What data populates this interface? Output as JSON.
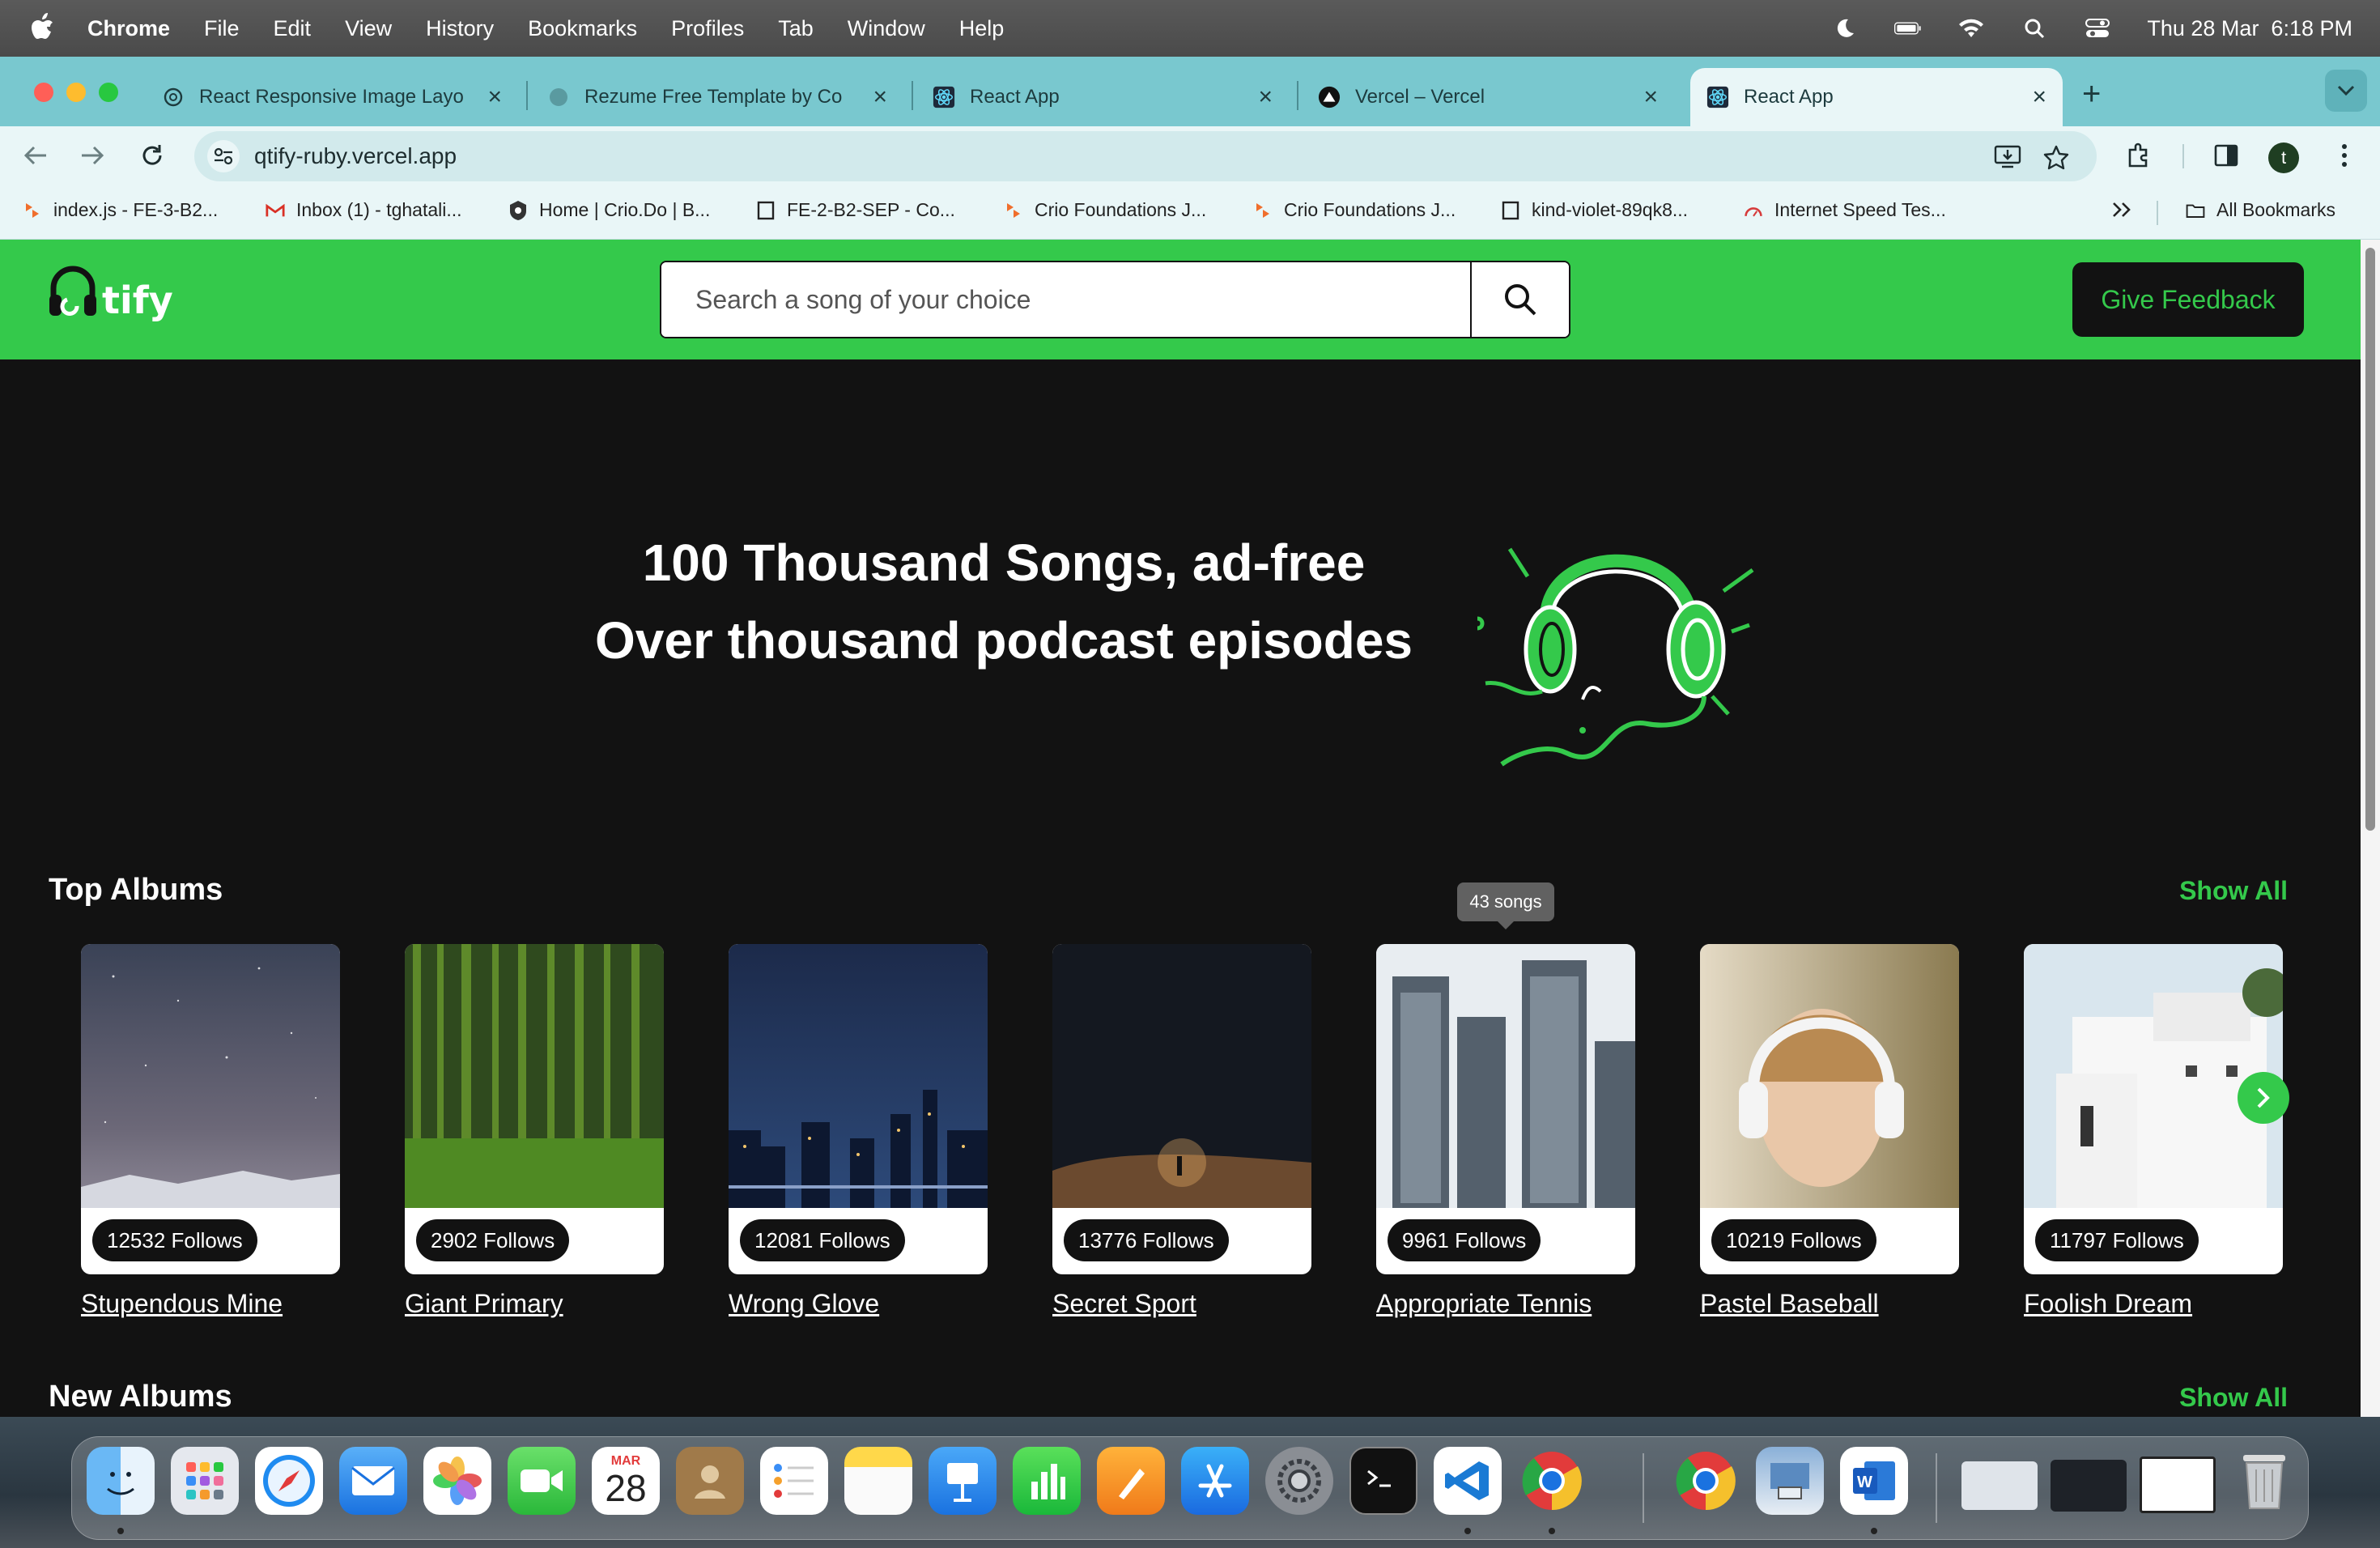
{
  "menubar": {
    "app": "Chrome",
    "items": [
      "File",
      "Edit",
      "View",
      "History",
      "Bookmarks",
      "Profiles",
      "Tab",
      "Window",
      "Help"
    ],
    "datetime": "Thu 28 Mar  6:18 PM"
  },
  "tabs": [
    {
      "title": "React Responsive Image Layo",
      "icon": "openai-icon"
    },
    {
      "title": "Rezume Free Template by Co",
      "icon": "globe-icon"
    },
    {
      "title": "React App",
      "icon": "react-icon"
    },
    {
      "title": "Vercel – Vercel",
      "icon": "vercel-icon"
    },
    {
      "title": "React App",
      "icon": "react-icon",
      "active": true
    }
  ],
  "omnibox": {
    "url": "qtify-ruby.vercel.app"
  },
  "profile_initial": "t",
  "bookmarks": [
    {
      "label": "index.js - FE-3-B2...",
      "icon": "crio-icon"
    },
    {
      "label": "Inbox (1) - tghatali...",
      "icon": "gmail-icon"
    },
    {
      "label": "Home | Crio.Do | B...",
      "icon": "crio-shield-icon"
    },
    {
      "label": "FE-2-B2-SEP - Co...",
      "icon": "page-icon"
    },
    {
      "label": "Crio Foundations J...",
      "icon": "crio-icon"
    },
    {
      "label": "Crio Foundations J...",
      "icon": "crio-icon"
    },
    {
      "label": "kind-violet-89qk8...",
      "icon": "page-icon"
    },
    {
      "label": "Internet Speed Tes...",
      "icon": "speedtest-icon"
    }
  ],
  "all_bookmarks": "All Bookmarks",
  "site": {
    "logo_text": "tify",
    "search_placeholder": "Search a song of your choice",
    "feedback_label": "Give Feedback",
    "hero_line1": "100 Thousand Songs, ad-free",
    "hero_line2": "Over thousand podcast episodes",
    "accent": "#34C94B"
  },
  "top_albums": {
    "title": "Top Albums",
    "show_all": "Show All",
    "tooltip": "43 songs",
    "cards": [
      {
        "follows": "12532 Follows",
        "name": "Stupendous Mine"
      },
      {
        "follows": "2902 Follows",
        "name": "Giant Primary"
      },
      {
        "follows": "12081 Follows",
        "name": "Wrong Glove"
      },
      {
        "follows": "13776 Follows",
        "name": "Secret Sport"
      },
      {
        "follows": "9961 Follows",
        "name": "Appropriate Tennis"
      },
      {
        "follows": "10219 Follows",
        "name": "Pastel Baseball"
      },
      {
        "follows": "11797 Follows",
        "name": "Foolish Dream"
      }
    ]
  },
  "new_albums": {
    "title": "New Albums",
    "show_all": "Show All"
  },
  "dock_calendar": {
    "month": "MAR",
    "day": "28"
  }
}
